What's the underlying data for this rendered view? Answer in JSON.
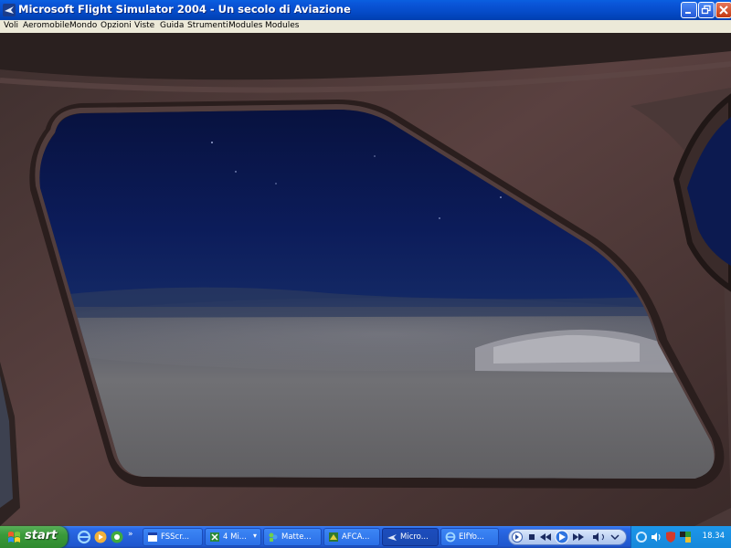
{
  "window": {
    "title": "Microsoft Flight Simulator 2004 - Un secolo di Aviazione",
    "controls": [
      "minimize",
      "maximize",
      "close"
    ]
  },
  "menu": {
    "items": [
      "Voli",
      "Aeromobile",
      "Mondo",
      "Opzioni",
      "Viste",
      "Guida",
      "Strumenti",
      "Modules",
      "Modules"
    ]
  },
  "viewport": {
    "scene": "night view through cockpit side window over snowy mountains"
  },
  "taskbar": {
    "start_label": "start",
    "tasks": [
      {
        "label": "FSScr...",
        "icon": "window-icon"
      },
      {
        "label": "4 Mi...",
        "icon": "excel-icon"
      },
      {
        "label": "Matte...",
        "icon": "messenger-icon"
      },
      {
        "label": "AFCA...",
        "icon": "app-icon"
      },
      {
        "label": "Micro...",
        "icon": "plane-icon"
      },
      {
        "label": "ElfYo...",
        "icon": "ie-icon"
      }
    ],
    "time": "18.34"
  },
  "colors": {
    "titlebar": "#0a55d8",
    "taskbar": "#2460d8",
    "start": "#3a9a3a",
    "tray": "#1688da",
    "cabin": "#4a3634",
    "sky": "#0c1a55"
  }
}
